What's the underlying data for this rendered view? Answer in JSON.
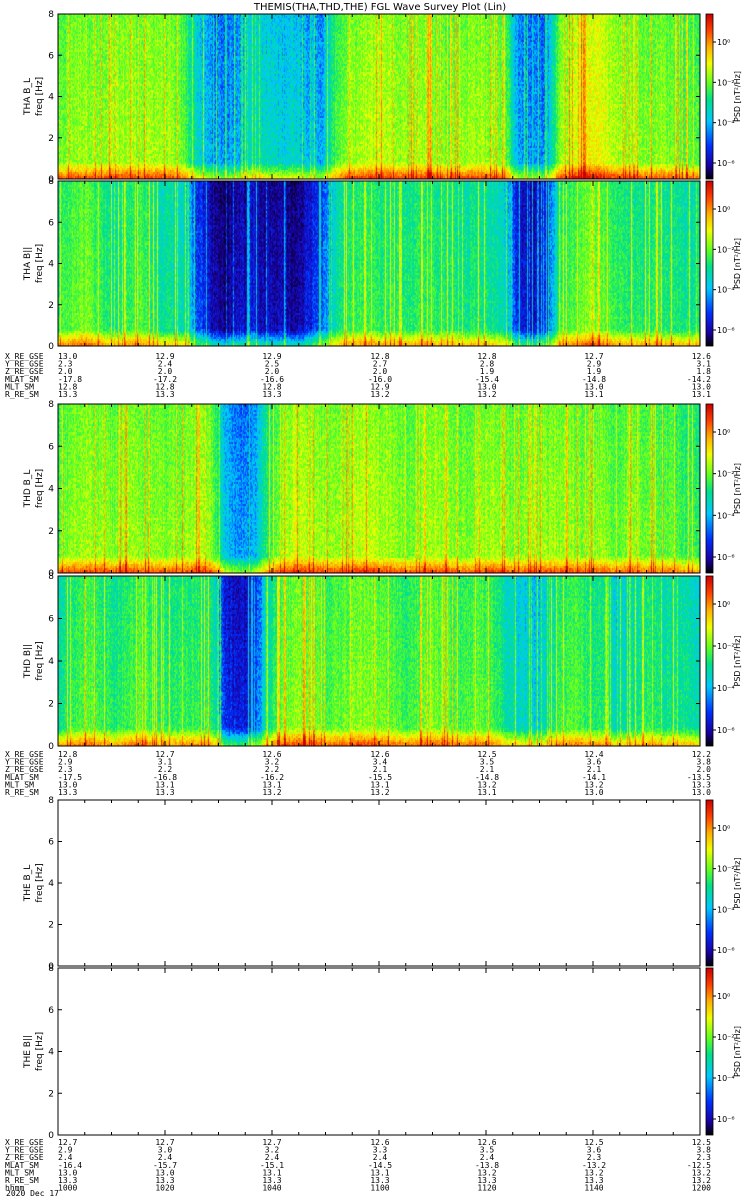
{
  "chart_data": {
    "type": "heatmap",
    "title": "THEMIS(THA,THD,THE) FGL Wave Survey Plot (Lin)",
    "date_label": "2020 Dec 17",
    "time_range_hhmm": [
      "1000",
      "1200"
    ],
    "freq_range_hz": [
      0,
      8
    ],
    "y_ticks": [
      "0",
      "2",
      "4",
      "6",
      "8"
    ],
    "colorbar_label": "PSD [nT²/Hz]",
    "colorbar_ticks": [
      "10⁰",
      "10⁻²",
      "10⁻⁴",
      "10⁻⁶"
    ],
    "colorscale": [
      "#000000",
      "#1a00a0",
      "#0030ff",
      "#00c8ff",
      "#00e08a",
      "#60ff20",
      "#f0ff00",
      "#ffb000",
      "#ff4000",
      "#c80000"
    ],
    "panels": [
      {
        "name": "THA B_L",
        "ylabel": "THA B_L",
        "sublabel": "freq [Hz]",
        "has_data": true,
        "profile": [
          0.55,
          0.6,
          0.62,
          0.58,
          0.6,
          0.62,
          0.6,
          0.62,
          0.6,
          0.55,
          0.4,
          0.32,
          0.3,
          0.35,
          0.42,
          0.4,
          0.38,
          0.4,
          0.35,
          0.33,
          0.55,
          0.6,
          0.62,
          0.65,
          0.62,
          0.6,
          0.62,
          0.6,
          0.58,
          0.6,
          0.62,
          0.6,
          0.58,
          0.32,
          0.3,
          0.3,
          0.6,
          0.65,
          0.7,
          0.68,
          0.62,
          0.6,
          0.58,
          0.6,
          0.58,
          0.55,
          0.55
        ]
      },
      {
        "name": "THA B||",
        "ylabel": "THA B||",
        "sublabel": "freq [Hz]",
        "has_data": true,
        "profile": [
          0.5,
          0.55,
          0.58,
          0.52,
          0.45,
          0.5,
          0.55,
          0.45,
          0.45,
          0.42,
          0.25,
          0.15,
          0.12,
          0.15,
          0.18,
          0.14,
          0.15,
          0.12,
          0.2,
          0.28,
          0.45,
          0.5,
          0.52,
          0.5,
          0.5,
          0.48,
          0.5,
          0.5,
          0.48,
          0.45,
          0.48,
          0.45,
          0.42,
          0.2,
          0.15,
          0.2,
          0.5,
          0.55,
          0.6,
          0.58,
          0.5,
          0.5,
          0.48,
          0.5,
          0.48,
          0.45,
          0.45
        ]
      },
      {
        "name": "THD B_L",
        "ylabel": "THD B_L",
        "sublabel": "freq [Hz]",
        "has_data": true,
        "profile": [
          0.55,
          0.6,
          0.62,
          0.6,
          0.58,
          0.62,
          0.6,
          0.6,
          0.58,
          0.6,
          0.62,
          0.6,
          0.35,
          0.3,
          0.32,
          0.5,
          0.6,
          0.65,
          0.62,
          0.6,
          0.6,
          0.62,
          0.65,
          0.62,
          0.6,
          0.58,
          0.6,
          0.62,
          0.6,
          0.58,
          0.6,
          0.62,
          0.6,
          0.58,
          0.6,
          0.6,
          0.62,
          0.6,
          0.58,
          0.6,
          0.55,
          0.6,
          0.58,
          0.55,
          0.55,
          0.52,
          0.5
        ]
      },
      {
        "name": "THD B||",
        "ylabel": "THD B||",
        "sublabel": "freq [Hz]",
        "has_data": true,
        "profile": [
          0.45,
          0.5,
          0.55,
          0.52,
          0.48,
          0.52,
          0.55,
          0.5,
          0.48,
          0.5,
          0.52,
          0.5,
          0.2,
          0.18,
          0.22,
          0.45,
          0.55,
          0.6,
          0.58,
          0.55,
          0.55,
          0.58,
          0.6,
          0.58,
          0.55,
          0.52,
          0.55,
          0.58,
          0.55,
          0.52,
          0.55,
          0.55,
          0.45,
          0.4,
          0.38,
          0.4,
          0.52,
          0.55,
          0.5,
          0.48,
          0.4,
          0.42,
          0.5,
          0.48,
          0.45,
          0.45,
          0.42
        ]
      },
      {
        "name": "THE B_L",
        "ylabel": "THE B_L",
        "sublabel": "freq [Hz]",
        "has_data": false,
        "profile": []
      },
      {
        "name": "THE B||",
        "ylabel": "THE B||",
        "sublabel": "freq [Hz]",
        "has_data": false,
        "profile": []
      }
    ],
    "orbit_tables": [
      {
        "labels": [
          "X_RE_GSE",
          "Y_RE_GSE",
          "Z_RE_GSE",
          "MLAT_SM",
          "MLT_SM",
          "R_RE_SM"
        ],
        "columns": [
          [
            "13.0",
            "2.3",
            "2.0",
            "-17.8",
            "12.8",
            "13.3"
          ],
          [
            "12.9",
            "2.4",
            "2.0",
            "-17.2",
            "12.8",
            "13.3"
          ],
          [
            "12.9",
            "2.5",
            "2.0",
            "-16.6",
            "12.8",
            "13.3"
          ],
          [
            "12.8",
            "2.7",
            "2.0",
            "-16.0",
            "12.9",
            "13.2"
          ],
          [
            "12.8",
            "2.8",
            "1.9",
            "-15.4",
            "13.0",
            "13.2"
          ],
          [
            "12.7",
            "2.9",
            "1.9",
            "-14.8",
            "13.0",
            "13.1"
          ],
          [
            "12.6",
            "3.1",
            "1.8",
            "-14.2",
            "13.0",
            "13.1"
          ]
        ]
      },
      {
        "labels": [
          "X_RE_GSE",
          "Y_RE_GSE",
          "Z_RE_GSE",
          "MLAT_SM",
          "MLT_SM",
          "R_RE_SM"
        ],
        "columns": [
          [
            "12.8",
            "2.9",
            "2.3",
            "-17.5",
            "13.0",
            "13.3"
          ],
          [
            "12.7",
            "3.1",
            "2.2",
            "-16.8",
            "13.1",
            "13.3"
          ],
          [
            "12.6",
            "3.2",
            "2.2",
            "-16.2",
            "13.1",
            "13.2"
          ],
          [
            "12.6",
            "3.4",
            "2.1",
            "-15.5",
            "13.1",
            "13.2"
          ],
          [
            "12.5",
            "3.5",
            "2.1",
            "-14.8",
            "13.2",
            "13.1"
          ],
          [
            "12.4",
            "3.6",
            "2.1",
            "-14.1",
            "13.2",
            "13.0"
          ],
          [
            "12.2",
            "3.8",
            "2.0",
            "-13.5",
            "13.3",
            "13.0"
          ]
        ]
      },
      {
        "labels": [
          "X_RE_GSE",
          "Y_RE_GSE",
          "Z_RE_GSE",
          "MLAT_SM",
          "MLT_SM",
          "R_RE_SM",
          "hhmm"
        ],
        "columns": [
          [
            "12.7",
            "2.9",
            "2.4",
            "-16.4",
            "13.0",
            "13.3",
            "1000"
          ],
          [
            "12.7",
            "3.0",
            "2.4",
            "-15.7",
            "13.0",
            "13.3",
            "1020"
          ],
          [
            "12.7",
            "3.2",
            "2.4",
            "-15.1",
            "13.1",
            "13.3",
            "1040"
          ],
          [
            "12.6",
            "3.3",
            "2.4",
            "-14.5",
            "13.1",
            "13.3",
            "1100"
          ],
          [
            "12.6",
            "3.5",
            "2.4",
            "-13.8",
            "13.2",
            "13.3",
            "1120"
          ],
          [
            "12.5",
            "3.6",
            "2.3",
            "-13.2",
            "13.2",
            "13.3",
            "1140"
          ],
          [
            "12.5",
            "3.8",
            "2.3",
            "-12.5",
            "13.2",
            "13.2",
            "1200"
          ]
        ]
      }
    ]
  }
}
